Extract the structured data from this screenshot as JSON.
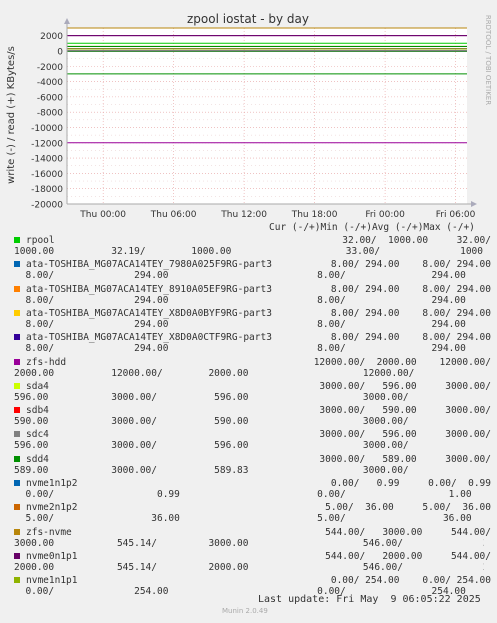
{
  "window": {
    "title": "zpool iostat - by day",
    "side_label": "RRDTOOL / TOBI OETIKER",
    "footer_update": "Last update: Fri May  9 06:05:22 2025",
    "footer_version": "Munin 2.0.49"
  },
  "chart_data": {
    "type": "line",
    "title": "zpool iostat - by day",
    "ylabel": "write (-) / read (+) KBytes/s",
    "ylim": [
      -20000,
      3000
    ],
    "yticks": [
      2000,
      0,
      -2000,
      -4000,
      -6000,
      -8000,
      -10000,
      -12000,
      -14000,
      -16000,
      -18000,
      -20000
    ],
    "ytick_labels": [
      "2000",
      "0",
      "-2000",
      "-4000",
      "-6000",
      "-8000",
      "-10000",
      "-12000",
      "-14000",
      "-16000",
      "-18000",
      "-20000"
    ],
    "xticks": [
      0.0904,
      0.3018,
      0.5133,
      0.7247,
      0.9361
    ],
    "xtick_labels": [
      "Thu 00:00",
      "Thu 06:00",
      "Thu 12:00",
      "Thu 18:00",
      "Fri 00:00",
      "Fri 06:00"
    ],
    "grid": true,
    "series": [
      {
        "name": "rpool",
        "color": "#00cc00",
        "y": 1000
      },
      {
        "name": "rpool (write)",
        "color": "#00cc00",
        "y": -32
      },
      {
        "name": "ata-TOSHIBA_MG07ACA14TEY_7980A025F9RG-part3",
        "color": "#0066b3",
        "y": 294
      },
      {
        "name": "ata-TOSHIBA_MG07ACA14TEY_8910A05EF9RG-part3",
        "color": "#ff8000",
        "y": 294
      },
      {
        "name": "ata-TOSHIBA_MG07ACA14TEY_X8D0A0BYF9RG-part3",
        "color": "#ffcc00",
        "y": 294
      },
      {
        "name": "ata-TOSHIBA_MG07ACA14TEY_X8D0A0CTF9RG-part3",
        "color": "#330099",
        "y": 294
      },
      {
        "name": "zfs-hdd",
        "color": "#990099",
        "y": 2000
      },
      {
        "name": "zfs-hdd (write)",
        "color": "#990099",
        "y": -12000
      },
      {
        "name": "sda4",
        "color": "#ccff00",
        "y": 596
      },
      {
        "name": "sdb4",
        "color": "#ff0000",
        "y": 590
      },
      {
        "name": "sdc4",
        "color": "#808080",
        "y": 596
      },
      {
        "name": "sdd4",
        "color": "#008f00",
        "y": 589
      },
      {
        "name": "sdd4 (write)",
        "color": "#008f00",
        "y": -3000
      },
      {
        "name": "zfs-nvme",
        "color": "#b8860b",
        "y": 3000
      },
      {
        "name": "nvme0n1p1",
        "color": "#660066",
        "y": 2000
      },
      {
        "name": "nvme1n1p1",
        "color": "#8fb300",
        "y": 254
      }
    ]
  },
  "legend": {
    "header": "Cur (-/+)Min (-/+)Avg (-/+)Max (-/+)",
    "rows": [
      {
        "name": "rpool",
        "color": "#00cc00",
        "line1": "32.00/  1000.00     32.00/",
        "line2": "1000.00          32.19/        1000.00                    33.00/              1000.00"
      },
      {
        "name": "ata-TOSHIBA_MG07ACA14TEY_7980A025F9RG-part3",
        "color": "#0066b3",
        "line1": "8.00/ 294.00    8.00/ 294.00",
        "line2": "  8.00/              294.00                          8.00/               294.00"
      },
      {
        "name": "ata-TOSHIBA_MG07ACA14TEY_8910A05EF9RG-part3",
        "color": "#ff8000",
        "line1": "8.00/ 294.00    8.00/ 294.00",
        "line2": "  8.00/              294.00                          8.00/               294.00"
      },
      {
        "name": "ata-TOSHIBA_MG07ACA14TEY_X8D0A0BYF9RG-part3",
        "color": "#ffcc00",
        "line1": "8.00/ 294.00    8.00/ 294.00",
        "line2": "  8.00/              294.00                          8.00/               294.00"
      },
      {
        "name": "ata-TOSHIBA_MG07ACA14TEY_X8D0A0CTF9RG-part3",
        "color": "#330099",
        "line1": "8.00/ 294.00    8.00/ 294.00",
        "line2": "  8.00/              294.00                          8.00/               294.00"
      },
      {
        "name": "zfs-hdd",
        "color": "#990099",
        "line1": "12000.00/  2000.00    12000.00/",
        "line2": "2000.00          12000.00/        2000.00                    12000.00/              2000.00"
      },
      {
        "name": "sda4",
        "color": "#ccff00",
        "line1": "3000.00/   596.00     3000.00/",
        "line2": "596.00           3000.00/          596.00                    3000.00/               596.00"
      },
      {
        "name": "sdb4",
        "color": "#ff0000",
        "line1": "3000.00/   590.00     3000.00/",
        "line2": "590.00           3000.00/          590.00                    3000.00/               590.00"
      },
      {
        "name": "sdc4",
        "color": "#808080",
        "line1": "3000.00/   596.00     3000.00/",
        "line2": "596.00           3000.00/          596.00                    3000.00/               596.00"
      },
      {
        "name": "sdd4",
        "color": "#008f00",
        "line1": "3000.00/   589.00     3000.00/",
        "line2": "589.00           3000.00/          589.83                    3000.00/               590.00"
      },
      {
        "name": "nvme1n1p2",
        "color": "#0066b3",
        "line1": "0.00/   0.99     0.00/  0.99",
        "line2": "  0.00/                  0.99                        0.00/                  1.00"
      },
      {
        "name": "nvme2n1p2",
        "color": "#cc6600",
        "line1": "5.00/  36.00     5.00/  36.00",
        "line2": "  5.00/                 36.00                        5.00/                 36.00"
      },
      {
        "name": "zfs-nvme",
        "color": "#b8860b",
        "line1": "544.00/   3000.00     544.00/",
        "line2": "3000.00           545.14/         3000.00                    546.00/              3000.00"
      },
      {
        "name": "nvme0n1p1",
        "color": "#660066",
        "line1": "544.00/   2000.00     544.00/",
        "line2": "2000.00           545.14/         2000.00                    546.00/              2000.00"
      },
      {
        "name": "nvme1n1p1",
        "color": "#8fb300",
        "line1": "0.00/ 254.00    0.00/ 254.00",
        "line2": "  0.00/              254.00                          0.00/               254.00"
      }
    ]
  }
}
